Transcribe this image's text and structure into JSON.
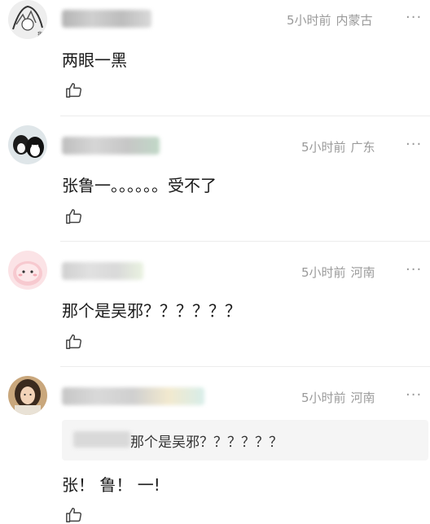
{
  "comments": [
    {
      "time": "5小时前",
      "location": "内蒙古",
      "text": "两眼一黑"
    },
    {
      "time": "5小时前",
      "location": "广东",
      "text": "张鲁一。。。。。。受不了"
    },
    {
      "time": "5小时前",
      "location": "河南",
      "text": "那个是吴邪？？？？？？"
    },
    {
      "time": "5小时前",
      "location": "河南",
      "text": "张！ 鲁！ 一!",
      "quote_text": "那个是吴邪？？？？？？"
    }
  ],
  "more_icon": "···",
  "icons": {
    "like": "thumbs-up-icon",
    "more": "more-dots-icon"
  }
}
